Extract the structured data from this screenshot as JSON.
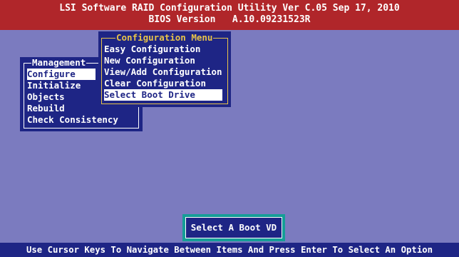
{
  "header": {
    "title": "LSI Software RAID Configuration Utility Ver C.05 Sep 17, 2010",
    "bios": "BIOS Version   A.10.09231523R"
  },
  "management_menu": {
    "title": "Management",
    "items": [
      "Configure",
      "Initialize",
      "Objects",
      "Rebuild",
      "Check Consistency"
    ],
    "selected": "Configure"
  },
  "configuration_menu": {
    "title": "Configuration Menu",
    "items": [
      "Easy Configuration",
      "New Configuration",
      "View/Add Configuration",
      "Clear Configuration",
      "Select Boot Drive"
    ],
    "selected": "Select Boot Drive"
  },
  "popup": {
    "label": "Select A Boot VD"
  },
  "status": "Use Cursor Keys To Navigate Between Items And Press Enter To Select An Option",
  "colors": {
    "background": "#7b7bbf",
    "title_bar": "#b0262a",
    "menu": "#1e2585",
    "menu_border_config": "#e7c34a",
    "popup": "#159e97"
  }
}
